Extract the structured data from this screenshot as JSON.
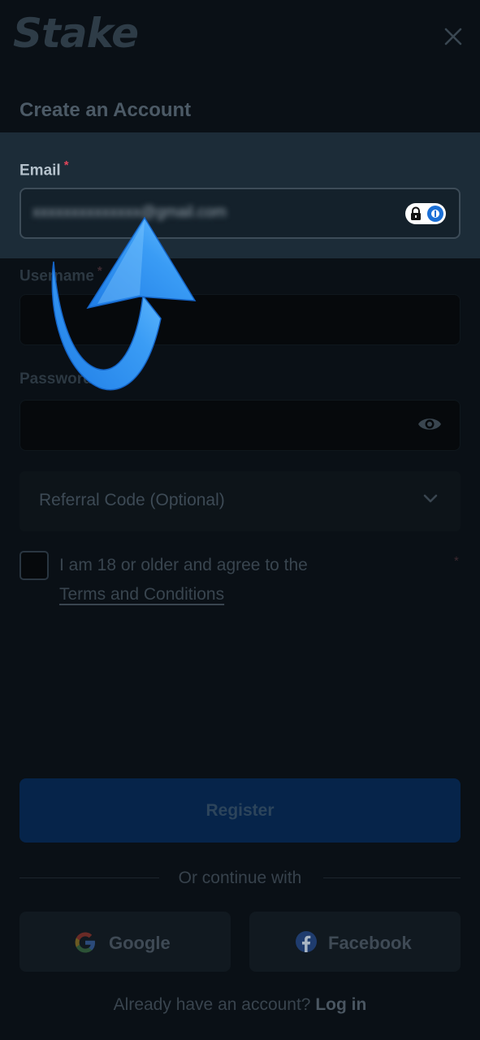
{
  "brand": {
    "logo_text": "Stake"
  },
  "modal": {
    "title": "Create an Account",
    "close_icon": "close-icon"
  },
  "form": {
    "email": {
      "label": "Email",
      "required_mark": "*",
      "value": "xxxxxxxxxxxxxx@gmail.com",
      "password_manager_icon": "1password-icon"
    },
    "username": {
      "label": "Username",
      "required_mark": "*",
      "value": ""
    },
    "password": {
      "label": "Password",
      "value": "",
      "toggle_icon": "eye-icon"
    },
    "referral": {
      "label": "Referral Code (Optional)",
      "icon": "chevron-down-icon"
    },
    "terms": {
      "text": "I am 18 or older and agree to the",
      "link": "Terms and Conditions",
      "required_mark": "*",
      "checked": false
    }
  },
  "actions": {
    "register_label": "Register",
    "divider_text": "Or continue with",
    "google_label": "Google",
    "facebook_label": "Facebook",
    "login_prompt": "Already have an account?",
    "login_link": "Log in"
  },
  "colors": {
    "background": "#0a1016",
    "highlight": "#1c2c38",
    "register": "#06244a",
    "required": "#e0455a",
    "annotation_arrow": "#2f8ff0"
  },
  "annotation": {
    "type": "curved-arrow",
    "points_to": "email-input"
  }
}
